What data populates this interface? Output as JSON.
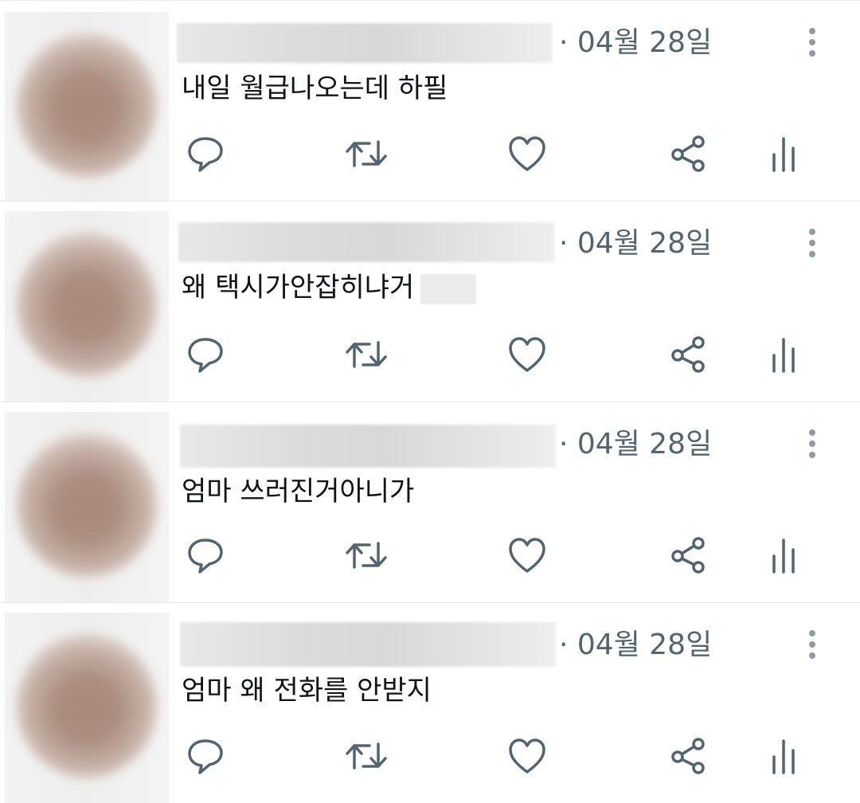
{
  "posts": [
    {
      "date": "· 04월 28일",
      "text": "내일 월급나오는데 하필",
      "redacted_tail": false,
      "icons": [
        "reply-icon",
        "retweet-icon",
        "like-icon",
        "share-icon",
        "stats-icon",
        "more-icon"
      ]
    },
    {
      "date": "· 04월 28일",
      "text": "왜 택시가안잡히냐거",
      "redacted_tail": true,
      "icons": [
        "reply-icon",
        "retweet-icon",
        "like-icon",
        "share-icon",
        "stats-icon",
        "more-icon"
      ]
    },
    {
      "date": "· 04월 28일",
      "text": "엄마 쓰러진거아니가",
      "redacted_tail": false,
      "icons": [
        "reply-icon",
        "retweet-icon",
        "like-icon",
        "share-icon",
        "stats-icon",
        "more-icon"
      ]
    },
    {
      "date": "· 04월 28일",
      "text": "엄마 왜 전화를 안받지",
      "redacted_tail": false,
      "icons": [
        "reply-icon",
        "retweet-icon",
        "like-icon",
        "share-icon",
        "stats-icon",
        "more-icon"
      ]
    }
  ],
  "colors": {
    "icon": "#536471",
    "text": "#0f1419",
    "meta": "#536471",
    "divider": "#e6e8ea"
  }
}
